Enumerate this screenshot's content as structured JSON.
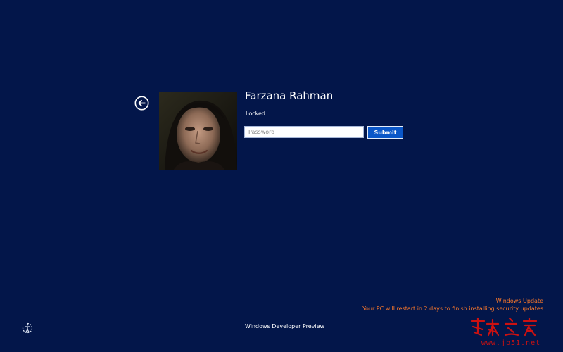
{
  "lock_screen": {
    "user_name": "Farzana Rahman",
    "status": "Locked",
    "password_placeholder": "Password",
    "password_value": "",
    "submit_label": "Submit"
  },
  "notification": {
    "title": "Windows Update",
    "message": "Your PC will restart in 2 days to finish installing security updates"
  },
  "footer": {
    "edition_label": "Windows Developer Preview"
  },
  "icons": {
    "back": "back-arrow-icon",
    "accessibility": "ease-of-access-icon"
  },
  "watermark": {
    "title": "脚本之家",
    "url": "www.jb51.net"
  },
  "colors": {
    "background": "#03164a",
    "accent_button": "#0b57c8",
    "notification_text": "#ff7a2a",
    "watermark": "#cc1111"
  }
}
